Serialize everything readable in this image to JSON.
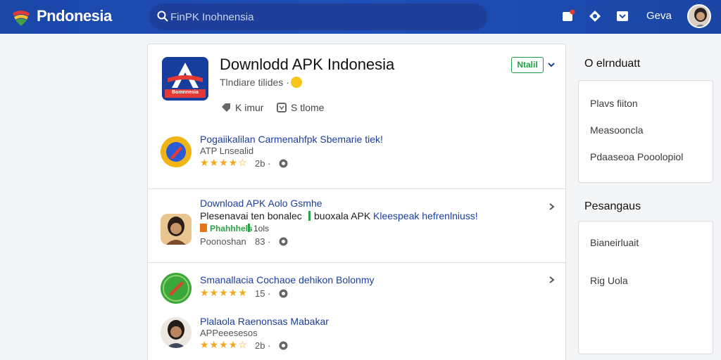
{
  "header": {
    "logo_text": "Pndonesia",
    "search_placeholder": "FinPK Inohnensia",
    "user_name": "Geva",
    "icons": [
      "logo-icon",
      "search-icon",
      "notification-icon",
      "location-icon",
      "download-icon",
      "avatar"
    ]
  },
  "app": {
    "title": "Downlodd APK Indonesia",
    "subtitle": "Tlndiare tilides ·",
    "icon_label": "Bomnnesia",
    "meta_left": "K imur",
    "meta_right": "S tlome",
    "install_label": "Ntalil"
  },
  "items": [
    {
      "title": "Pogaiikalilan Carmenahfpk Sbemarie tiek!",
      "meta": "ATP Lnsealid",
      "rating": 4,
      "count": "2b ·"
    },
    {
      "title": "Download APK Aolo Gsmhe",
      "desc_a": "Plesenavai ten bonalec",
      "desc_b": "buoxala APK",
      "desc_c": "Kleespeak hefrenlniuss!",
      "rating_text": "Phahhhels",
      "rating_extra": "1ols",
      "meta": "Poonoshan",
      "count": "83 ·"
    },
    {
      "title": "Smanallacia Cochaoe dehikon Bolonmy",
      "rating": 5,
      "count": "15 ·"
    },
    {
      "title": "Plalaola Raenonsas Mabakar",
      "meta": "APPeeesesos",
      "rating": 4,
      "count": "2b ·"
    }
  ],
  "sidebar": {
    "section1_title": "O elrnduatt",
    "section1_items": [
      "Plavs fiiton",
      "Measooncla",
      "Pdaaseoa Pooolopiol"
    ],
    "section2_title": "Pesangaus",
    "section2_items": [
      "Bianeirluait",
      "Rig Uola"
    ]
  },
  "colors": {
    "header_bg": "#1f4fb8",
    "link_blue": "#1a3f9c",
    "install_green": "#1f9d46",
    "star": "#f4a81d"
  }
}
